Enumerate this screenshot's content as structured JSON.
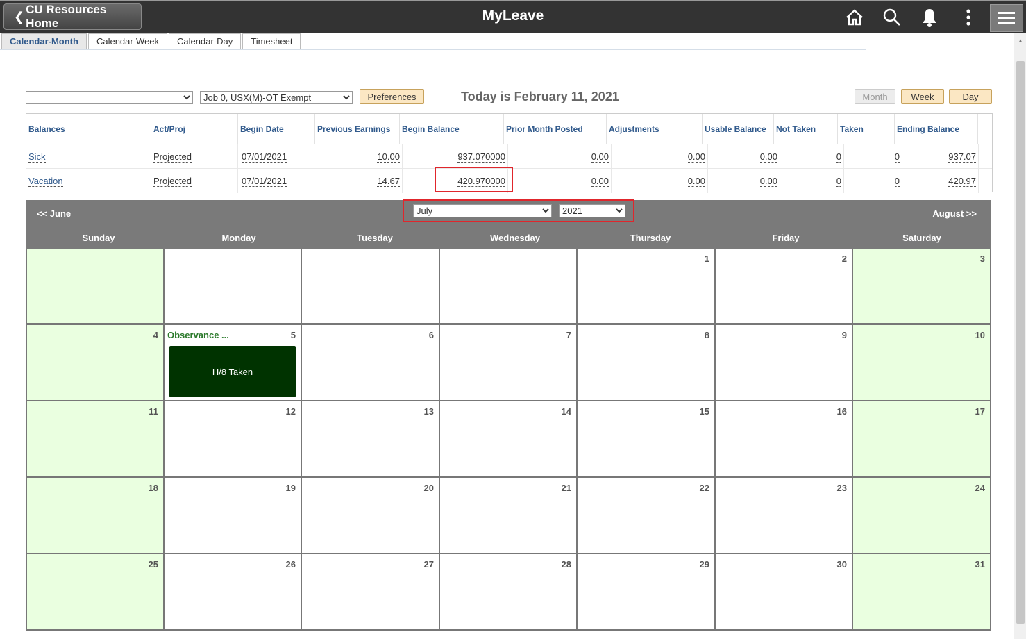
{
  "header": {
    "home_button": "CU Resources Home",
    "title": "MyLeave"
  },
  "tabs": [
    {
      "label": "Calendar-Month"
    },
    {
      "label": "Calendar-Week"
    },
    {
      "label": "Calendar-Day"
    },
    {
      "label": "Timesheet"
    }
  ],
  "toolbar": {
    "first_select": "",
    "job_select": "Job 0, USX(M)-OT Exempt",
    "preferences": "Preferences",
    "today": "Today is February 11, 2021",
    "view_month": "Month",
    "view_week": "Week",
    "view_day": "Day"
  },
  "balances": {
    "headers": [
      "Balances",
      "Act/Proj",
      "Begin Date",
      "Previous Earnings",
      "Begin Balance",
      "Prior Month Posted",
      "Adjustments",
      "Usable Balance",
      "Not Taken",
      "Taken",
      "Ending Balance"
    ],
    "rows": [
      {
        "type": "Sick",
        "actproj": "Projected",
        "begin_date": "07/01/2021",
        "prev_earnings": "10.00",
        "begin_balance": "937.070000",
        "prior_month": "0.00",
        "adjustments": "0.00",
        "usable": "0.00",
        "not_taken": "0",
        "taken": "0",
        "ending": "937.07"
      },
      {
        "type": "Vacation",
        "actproj": "Projected",
        "begin_date": "07/01/2021",
        "prev_earnings": "14.67",
        "begin_balance": "420.970000",
        "prior_month": "0.00",
        "adjustments": "0.00",
        "usable": "0.00",
        "not_taken": "0",
        "taken": "0",
        "ending": "420.97"
      }
    ]
  },
  "calendar": {
    "prev": "<< June",
    "next": "August >>",
    "month": "July",
    "year": "2021",
    "days": [
      "Sunday",
      "Monday",
      "Tuesday",
      "Wednesday",
      "Thursday",
      "Friday",
      "Saturday"
    ],
    "weeks": [
      [
        "",
        "",
        "",
        "",
        "1",
        "2",
        "3"
      ],
      [
        "4",
        "5",
        "6",
        "7",
        "8",
        "9",
        "10"
      ],
      [
        "11",
        "12",
        "13",
        "14",
        "15",
        "16",
        "17"
      ],
      [
        "18",
        "19",
        "20",
        "21",
        "22",
        "23",
        "24"
      ],
      [
        "25",
        "26",
        "27",
        "28",
        "29",
        "30",
        "31"
      ]
    ],
    "observance_label": "Observance ...",
    "event_label": "H/8 Taken"
  }
}
